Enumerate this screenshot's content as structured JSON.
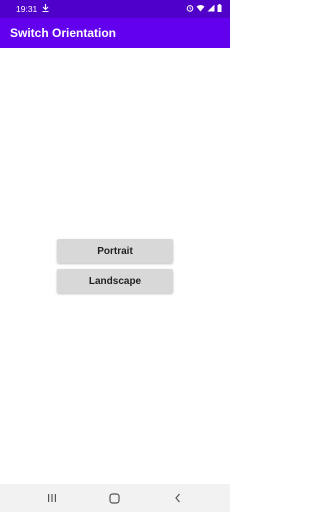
{
  "status_bar": {
    "time": "19:31",
    "left_icons": [
      "download-icon"
    ],
    "right_icons": [
      "alarm-icon",
      "wifi-icon",
      "signal-icon",
      "battery-icon"
    ]
  },
  "app_bar": {
    "title": "Switch Orientation",
    "color": "#6200ee"
  },
  "buttons": {
    "portrait_label": "Portrait",
    "landscape_label": "Landscape"
  },
  "nav_bar": {
    "items": [
      "recent-apps-icon",
      "home-icon",
      "back-icon"
    ]
  },
  "colors": {
    "status_bar": "#4f00c9",
    "button_bg": "#d8d8d8"
  }
}
